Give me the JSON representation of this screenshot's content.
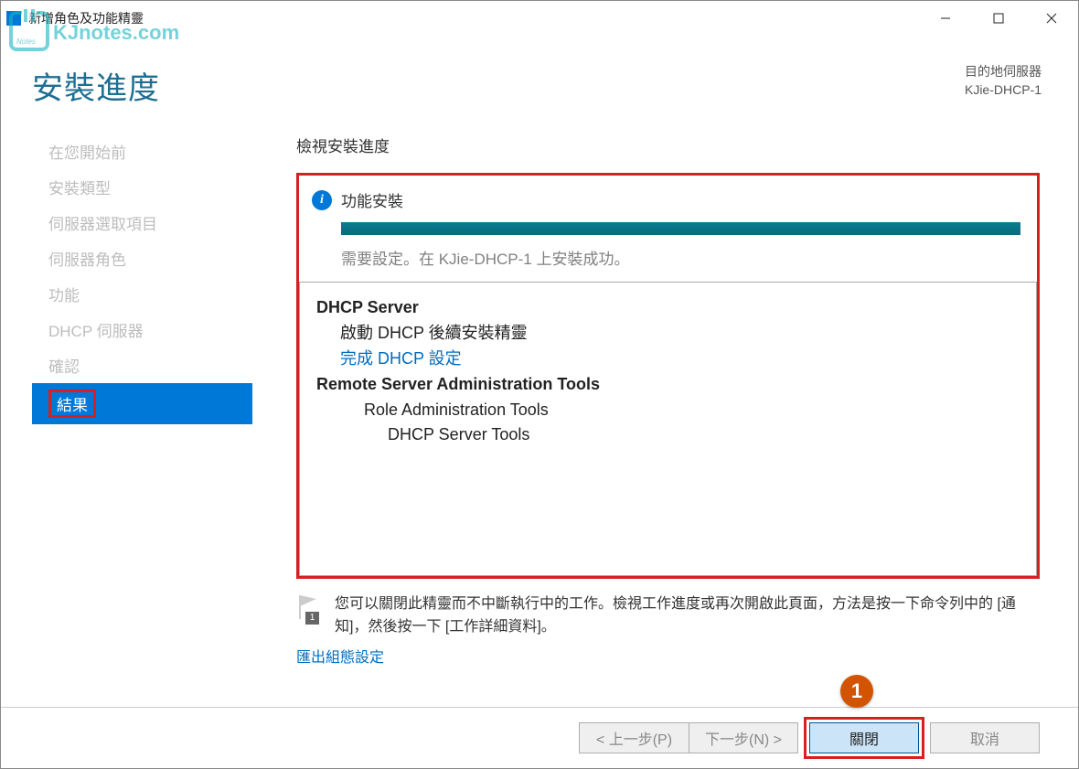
{
  "window": {
    "title": "新增角色及功能精靈"
  },
  "watermark_text": "KJnotes.com",
  "header": {
    "page_title": "安裝進度",
    "dest_label": "目的地伺服器",
    "dest_server": "KJie-DHCP-1"
  },
  "sidebar": {
    "items": [
      {
        "label": "在您開始前",
        "active": false
      },
      {
        "label": "安裝類型",
        "active": false
      },
      {
        "label": "伺服器選取項目",
        "active": false
      },
      {
        "label": "伺服器角色",
        "active": false
      },
      {
        "label": "功能",
        "active": false
      },
      {
        "label": "DHCP 伺服器",
        "active": false
      },
      {
        "label": "確認",
        "active": false
      },
      {
        "label": "結果",
        "active": true
      }
    ]
  },
  "main": {
    "section_heading": "檢視安裝進度",
    "install_status_label": "功能安裝",
    "install_status_msg": "需要設定。在 KJie-DHCP-1 上安裝成功。",
    "results": {
      "role_title": "DHCP Server",
      "role_sub": "啟動 DHCP 後續安裝精靈",
      "role_link": "完成 DHCP 設定",
      "rsat_title": "Remote Server Administration Tools",
      "rsat_sub1": "Role Administration Tools",
      "rsat_sub2": "DHCP Server Tools"
    },
    "footer_note": "您可以關閉此精靈而不中斷執行中的工作。檢視工作進度或再次開啟此頁面，方法是按一下命令列中的 [通知]，然後按一下 [工作詳細資料]。",
    "flag_count": "1",
    "export_link": "匯出組態設定"
  },
  "buttons": {
    "prev": "< 上一步(P)",
    "next": "下一步(N) >",
    "close": "關閉",
    "cancel": "取消"
  },
  "callout": "1"
}
